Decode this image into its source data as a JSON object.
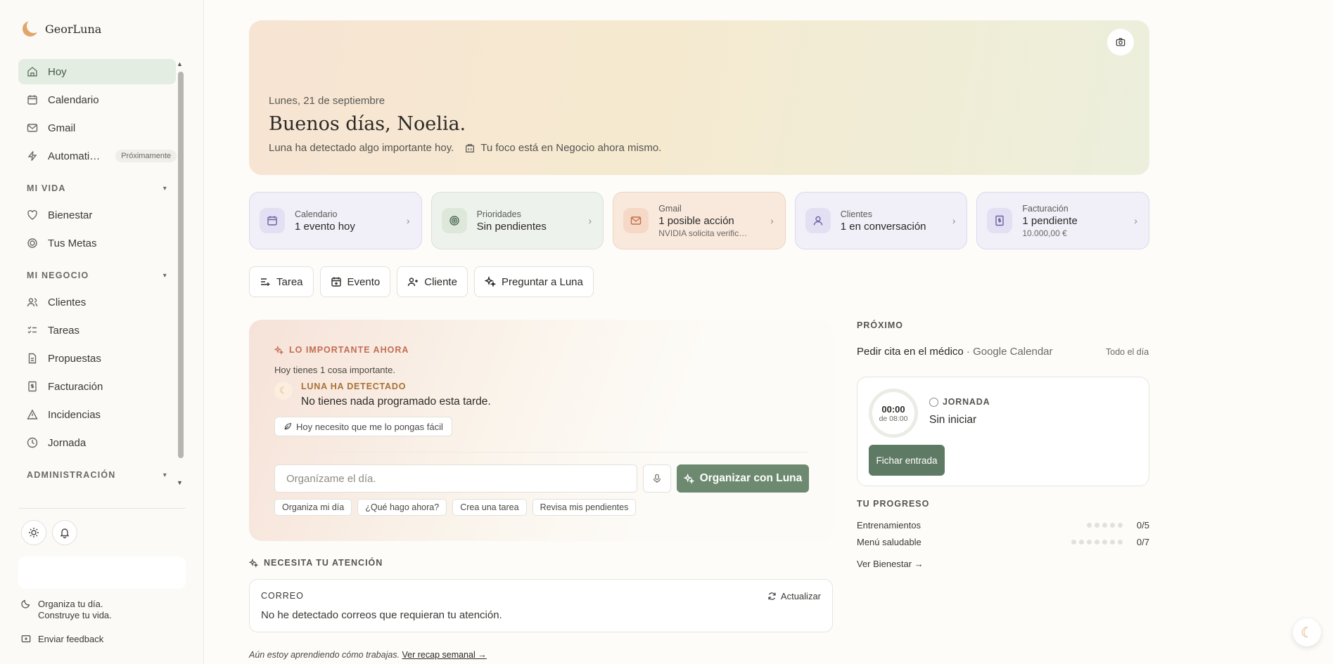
{
  "brand": {
    "name": "GeorLuna"
  },
  "nav": {
    "items": [
      {
        "label": "Hoy",
        "icon": "home-icon"
      },
      {
        "label": "Calendario",
        "icon": "calendar-icon"
      },
      {
        "label": "Gmail",
        "icon": "mail-icon"
      },
      {
        "label": "Automati…",
        "icon": "bolt-icon",
        "badge": "Próximamente"
      }
    ],
    "sections": [
      {
        "title": "MI VIDA",
        "items": [
          {
            "label": "Bienestar",
            "icon": "heart-icon"
          },
          {
            "label": "Tus Metas",
            "icon": "target-icon"
          }
        ]
      },
      {
        "title": "MI NEGOCIO",
        "items": [
          {
            "label": "Clientes",
            "icon": "users-icon"
          },
          {
            "label": "Tareas",
            "icon": "checklist-icon"
          },
          {
            "label": "Propuestas",
            "icon": "document-icon"
          },
          {
            "label": "Facturación",
            "icon": "invoice-icon"
          },
          {
            "label": "Incidencias",
            "icon": "warning-icon"
          },
          {
            "label": "Jornada",
            "icon": "clock-icon"
          }
        ]
      },
      {
        "title": "ADMINISTRACIÓN",
        "items": []
      }
    ]
  },
  "footer": {
    "tagline_1": "Organiza tu día.",
    "tagline_2": "Construye tu vida.",
    "feedback": "Enviar feedback"
  },
  "hero": {
    "date": "Lunes, 21 de septiembre",
    "greeting": "Buenos días, Noelia.",
    "detected": "Luna ha detectado algo importante hoy.",
    "focus": "Tu foco está en Negocio ahora mismo."
  },
  "cards": [
    {
      "label": "Calendario",
      "value": "1 evento hoy",
      "sub": ""
    },
    {
      "label": "Prioridades",
      "value": "Sin pendientes",
      "sub": ""
    },
    {
      "label": "Gmail",
      "value": "1 posible acción",
      "sub": "NVIDIA solicita verific…"
    },
    {
      "label": "Clientes",
      "value": "1 en conversación",
      "sub": ""
    },
    {
      "label": "Facturación",
      "value": "1 pendiente",
      "sub": "10.000,00 €"
    }
  ],
  "actions": {
    "tarea": "Tarea",
    "evento": "Evento",
    "cliente": "Cliente",
    "preguntar": "Preguntar a Luna"
  },
  "important": {
    "header": "LO IMPORTANTE AHORA",
    "count": "Hoy tienes 1 cosa importante.",
    "detected_header": "LUNA HA DETECTADO",
    "detected_text": "No tienes nada programado esta tarde.",
    "easy_button": "Hoy necesito que me lo pongas fácil",
    "input_placeholder": "Organízame el día.",
    "organize_button": "Organizar con Luna",
    "chips": [
      "Organiza mi día",
      "¿Qué hago ahora?",
      "Crea una tarea",
      "Revisa mis pendientes"
    ]
  },
  "attention": {
    "header": "NECESITA TU ATENCIÓN",
    "mail_header": "CORREO",
    "mail_text": "No he detectado correos que requieran tu atención.",
    "refresh": "Actualizar"
  },
  "footnote": {
    "text": "Aún estoy aprendiendo cómo trabajas.",
    "link": "Ver recap semanal →"
  },
  "proximo": {
    "header": "PRÓXIMO",
    "event": "Pedir cita en el médico",
    "source": "· Google Calendar",
    "when": "Todo el día"
  },
  "jornada": {
    "time": "00:00",
    "of": "de 08:00",
    "header": "JORNADA",
    "status": "Sin iniciar",
    "button": "Fichar entrada"
  },
  "progress": {
    "header": "TU PROGRESO",
    "rows": [
      {
        "label": "Entrenamientos",
        "value": "0/5",
        "done": 0,
        "total": 5
      },
      {
        "label": "Menú saludable",
        "value": "0/7",
        "done": 0,
        "total": 7
      }
    ],
    "link": "Ver Bienestar →"
  }
}
